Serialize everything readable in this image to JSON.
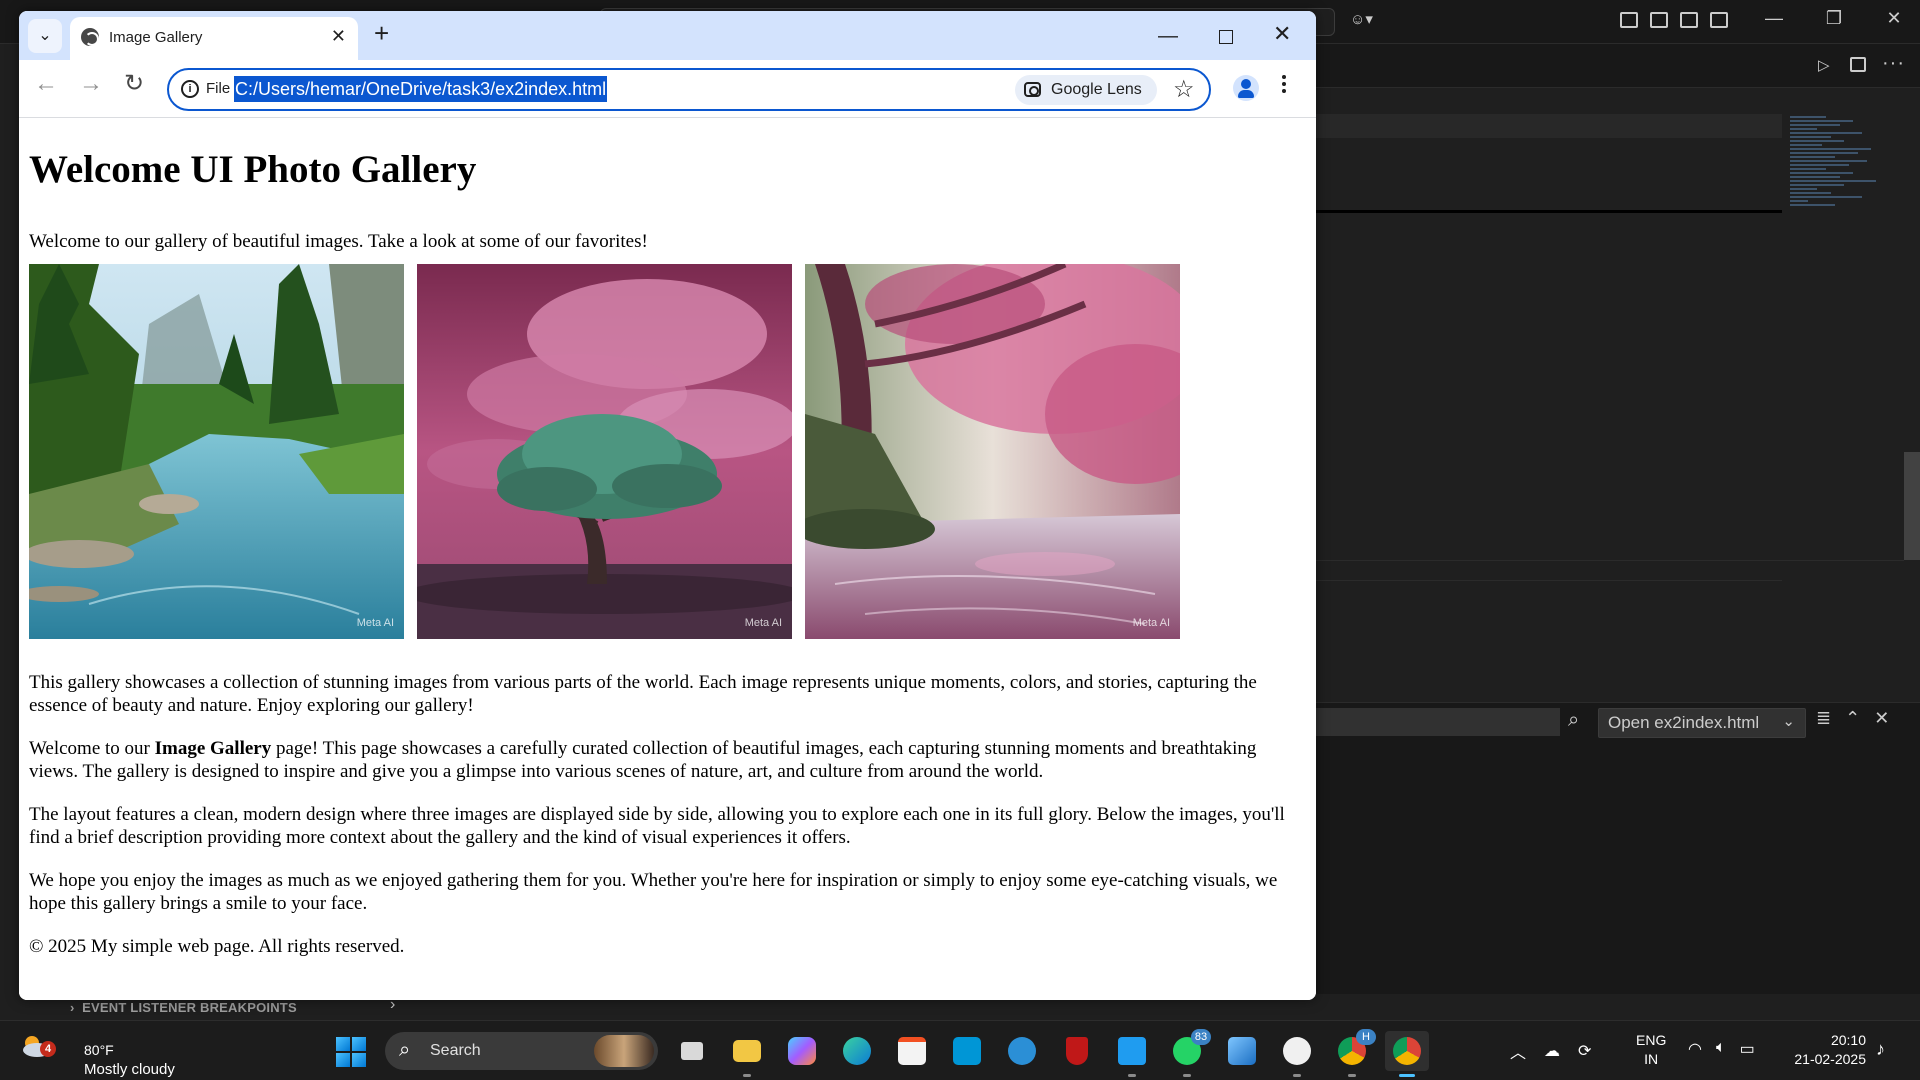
{
  "browser": {
    "tab_title": "Image Gallery",
    "scheme_label": "File",
    "url": "C:/Users/hemar/OneDrive/task3/ex2index.html",
    "lens_label": "Google Lens"
  },
  "page": {
    "heading": "Welcome UI Photo Gallery",
    "intro": "Welcome to our gallery of beautiful images. Take a look at some of our favorites!",
    "images": [
      {
        "watermark": "Meta AI",
        "subject": "forest river landscape"
      },
      {
        "watermark": "Meta AI",
        "subject": "lone tree under pink clouds"
      },
      {
        "watermark": "Meta AI",
        "subject": "pink blossom tree by river"
      }
    ],
    "paragraph1": "This gallery showcases a collection of stunning images from various parts of the world. Each image represents unique moments, colors, and stories, capturing the essence of beauty and nature. Enjoy exploring our gallery!",
    "paragraph2_before": "Welcome to our ",
    "paragraph2_bold": "Image Gallery",
    "paragraph2_after": " page! This page showcases a carefully curated collection of beautiful images, each capturing stunning moments and breathtaking views. The gallery is designed to inspire and give you a glimpse into various scenes of nature, art, and culture from around the world.",
    "paragraph3": "The layout features a clean, modern design where three images are displayed side by side, allowing you to explore each one in its full glory. Below the images, you'll find a brief description providing more context about the gallery and the kind of visual experiences it offers.",
    "paragraph4": "We hope you enjoy the images as much as we enjoyed gathering them for you. Whether you're here for inspiration or simply to enjoy some eye-catching visuals, we hope this gallery brings a smile to your face.",
    "footer": "© 2025 My simple web page. All rights reserved."
  },
  "vscode": {
    "open_select": "Open ex2index.html",
    "debug_section": "EVENT LISTENER BREAKPOINTS"
  },
  "taskbar": {
    "weather_temp": "80°F",
    "weather_desc": "Mostly cloudy",
    "weather_badge": "4",
    "search_label": "Search",
    "whatsapp_badge": "83",
    "chrome_profile_badge": "H",
    "lang_line1": "ENG",
    "lang_line2": "IN",
    "time": "20:10",
    "date": "21-02-2025"
  },
  "colors": {
    "accent": "#0b57d0",
    "tabstrip": "#d3e3fd",
    "vscode_bg": "#1f1f1f",
    "taskbar_bg": "#1c1c1c"
  }
}
